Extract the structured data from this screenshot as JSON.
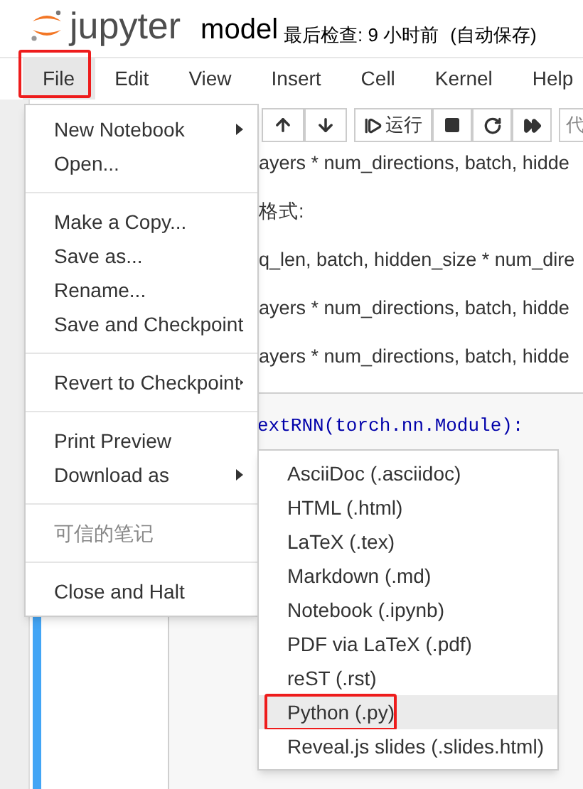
{
  "header": {
    "logo": "jupyter",
    "notebook_name": "model",
    "checkpoint": "最后检查: 9 小时前",
    "autosave": "(自动保存)"
  },
  "menubar": [
    {
      "label": "File",
      "selected": true
    },
    {
      "label": "Edit",
      "selected": false
    },
    {
      "label": "View",
      "selected": false
    },
    {
      "label": "Insert",
      "selected": false
    },
    {
      "label": "Cell",
      "selected": false
    },
    {
      "label": "Kernel",
      "selected": false
    },
    {
      "label": "Help",
      "selected": false
    }
  ],
  "toolbar": {
    "run_label": "运行",
    "cell_type": "代"
  },
  "cell_lines": [
    "ayers * num_directions, batch, hidde",
    "格式:",
    "q_len, batch, hidden_size * num_dire",
    "ayers * num_directions, batch, hidde",
    "ayers * num_directions, batch, hidde"
  ],
  "code_line": "extRNN(torch.nn.Module):",
  "file_menu": [
    {
      "kind": "item",
      "label": "New Notebook",
      "submenu": true,
      "disabled": false
    },
    {
      "kind": "item",
      "label": "Open...",
      "submenu": false,
      "disabled": false
    },
    {
      "kind": "divider"
    },
    {
      "kind": "item",
      "label": "Make a Copy...",
      "submenu": false,
      "disabled": false
    },
    {
      "kind": "item",
      "label": "Save as...",
      "submenu": false,
      "disabled": false
    },
    {
      "kind": "item",
      "label": "Rename...",
      "submenu": false,
      "disabled": false
    },
    {
      "kind": "item",
      "label": "Save and Checkpoint",
      "submenu": false,
      "disabled": false
    },
    {
      "kind": "divider"
    },
    {
      "kind": "item",
      "label": "Revert to Checkpoint",
      "submenu": true,
      "disabled": false
    },
    {
      "kind": "divider"
    },
    {
      "kind": "item",
      "label": "Print Preview",
      "submenu": false,
      "disabled": false
    },
    {
      "kind": "item",
      "label": "Download as",
      "submenu": true,
      "disabled": false
    },
    {
      "kind": "divider"
    },
    {
      "kind": "item",
      "label": "可信的笔记",
      "submenu": false,
      "disabled": true
    },
    {
      "kind": "divider"
    },
    {
      "kind": "item",
      "label": "Close and Halt",
      "submenu": false,
      "disabled": false
    }
  ],
  "download_menu": [
    {
      "label": "AsciiDoc (.asciidoc)",
      "selected": false
    },
    {
      "label": "HTML (.html)",
      "selected": false
    },
    {
      "label": "LaTeX (.tex)",
      "selected": false
    },
    {
      "label": "Markdown (.md)",
      "selected": false
    },
    {
      "label": "Notebook (.ipynb)",
      "selected": false
    },
    {
      "label": "PDF via LaTeX (.pdf)",
      "selected": false
    },
    {
      "label": "reST (.rst)",
      "selected": false
    },
    {
      "label": "Python (.py)",
      "selected": true
    },
    {
      "label": "Reveal.js slides (.slides.html)",
      "selected": false
    }
  ]
}
